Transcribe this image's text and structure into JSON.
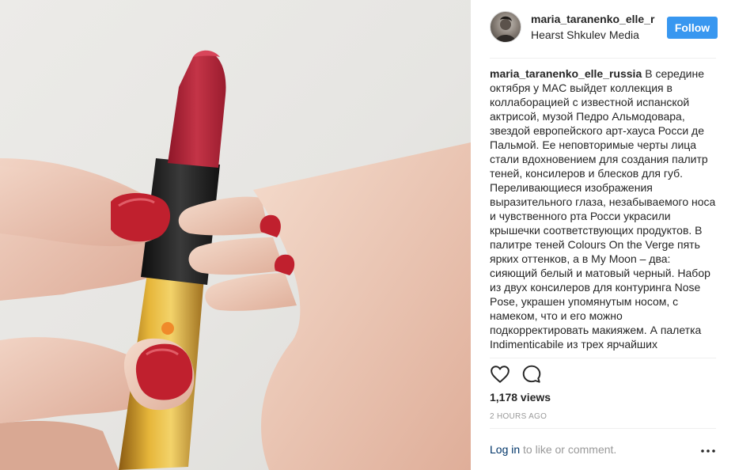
{
  "post": {
    "media_description_icon": "lipstick-video",
    "header": {
      "username": "maria_taranenko_elle_r",
      "location": "Hearst Shkulev Media",
      "follow_label": "Follow"
    },
    "caption": {
      "author": "maria_taranenko_elle_russia",
      "text": "В середине октября у MAC выйдет коллекция в коллаборацией с известной испанской актрисой, музой Педро Альмодовара, звездой европейского арт-хауса Росси де Пальмой. Ее неповторимые черты лица стали вдохновением для создания палитр теней, консилеров и блесков для губ. Переливающиеся изображения выразительного глаза, незабываемого носа и чувственного рта Росси украсили крышечки соответствующих продуктов. В палитре теней Colours On the Verge пять ярких оттенков, а в My Moon – два: сияющий белый и матовый черный. Набор из двух консилеров для контуринга Nose Pose, украшен упомянутым носом, с намеком, что и его можно подкорректировать макияжем. А палетка Indimenticabile из трех ярчайших"
    },
    "stats": {
      "views": "1,178 views",
      "timestamp": "2 HOURS AGO"
    },
    "footer": {
      "login_label": "Log in",
      "login_suffix": " to like or comment."
    },
    "icons": {
      "like": "heart-icon",
      "comment": "comment-icon",
      "more": "more-options-icon"
    },
    "colors": {
      "accent": "#3897f0",
      "lipstick": "#b8283c",
      "nail_polish": "#c0202e",
      "muted_text": "#999999"
    }
  }
}
